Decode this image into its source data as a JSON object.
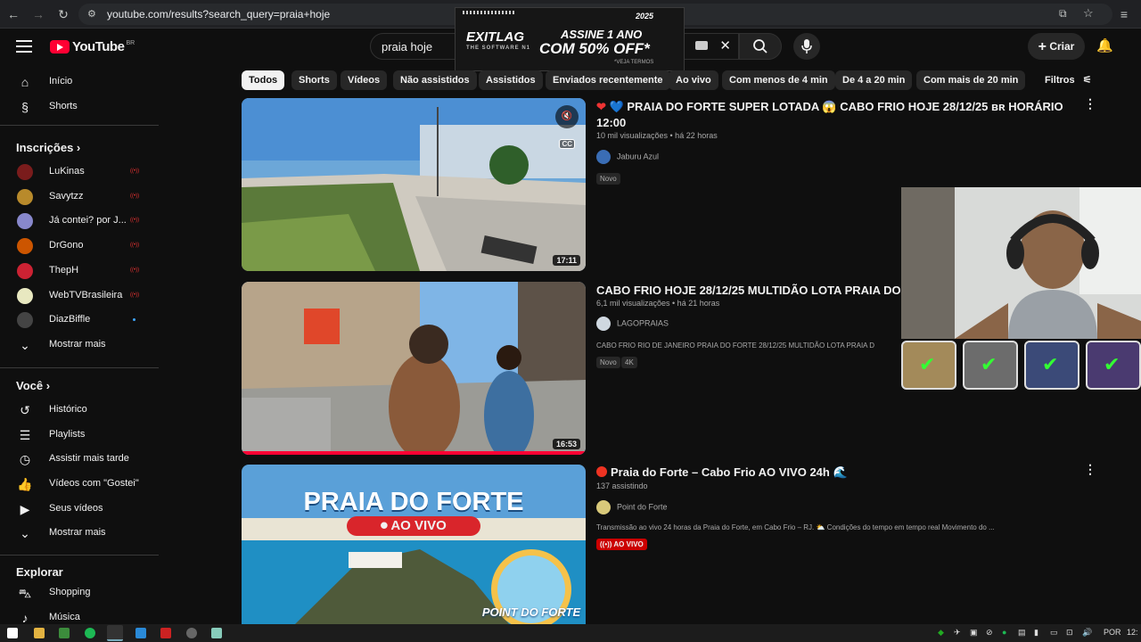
{
  "browser": {
    "url": "youtube.com/results?search_query=praia+hoje"
  },
  "ad": {
    "logo": "EXITLAG",
    "logo_sub": "THE SOFTWARE N1",
    "line1": "ASSINE 1 ANO",
    "line2": "COM 50% OFF*",
    "line3": "*VEJA TERMOS",
    "badge": "2025"
  },
  "masthead": {
    "logo_text": "YouTube",
    "country": "BR",
    "search_value": "praia hoje",
    "create_label": "Criar"
  },
  "sidebar": {
    "main": [
      {
        "label": "Início",
        "icon": "home-icon"
      },
      {
        "label": "Shorts",
        "icon": "shorts-icon"
      }
    ],
    "subs_header": "Inscrições",
    "subs": [
      {
        "label": "LuKinas",
        "live": true,
        "color": "#7a1c1c"
      },
      {
        "label": "Savytzz",
        "live": true,
        "color": "#b88a2b"
      },
      {
        "label": "Já contei? por J...",
        "live": true,
        "color": "#8888cc"
      },
      {
        "label": "DrGono",
        "live": true,
        "color": "#cc5500"
      },
      {
        "label": "ThepH",
        "live": true,
        "color": "#cc2233"
      },
      {
        "label": "WebTVBrasileira",
        "live": true,
        "color": "#e8e8c0"
      },
      {
        "label": "DiazBiffle",
        "live": false,
        "color": "#444"
      }
    ],
    "show_more_1": "Mostrar mais",
    "you_header": "Você",
    "you": [
      {
        "label": "Histórico",
        "icon": "history-icon"
      },
      {
        "label": "Playlists",
        "icon": "playlists-icon"
      },
      {
        "label": "Assistir mais tarde",
        "icon": "watch-later-icon"
      },
      {
        "label": "Vídeos com \"Gostei\"",
        "icon": "like-icon"
      },
      {
        "label": "Seus vídeos",
        "icon": "your-videos-icon"
      }
    ],
    "show_more_2": "Mostrar mais",
    "explore_header": "Explorar",
    "explore": [
      {
        "label": "Shopping",
        "icon": "shopping-icon"
      },
      {
        "label": "Música",
        "icon": "music-icon"
      }
    ]
  },
  "chips": [
    "Todos",
    "Shorts",
    "Vídeos",
    "Não assistidos",
    "Assistidos",
    "Enviados recentemente",
    "Ao vivo",
    "Com menos de 4 min",
    "De 4 a 20 min",
    "Com mais de 20 min"
  ],
  "filters_label": "Filtros",
  "results": [
    {
      "title": "PRAIA DO FORTE SUPER LOTADA 😱 CABO FRIO HOJE 28/12/25 ʙʀ HORÁRIO",
      "title2": "12:00",
      "meta": "10 mil visualizações • há 22 horas",
      "channel": "Jaburu Azul",
      "duration": "17:11",
      "badges": [
        "Novo"
      ],
      "desc": ""
    },
    {
      "title": "CABO FRIO HOJE 28/12/25 MULTIDÃO LOTA PRAIA DO",
      "meta": "6,1 mil visualizações • há 21 horas",
      "channel": "LAGOPRAIAS",
      "duration": "16:53",
      "desc": "CABO FRIO RIO DE JANEIRO PRAIA DO FORTE 28/12/25 MULTIDÃO LOTA PRAIA D",
      "badges": [
        "Novo",
        "4K"
      ]
    },
    {
      "title": "Praia do Forte – Cabo Frio AO VIVO 24h 🌊",
      "meta": "137 assistindo",
      "channel": "Point do Forte",
      "desc": "Transmissão ao vivo 24 horas da Praia do Forte, em Cabo Frio – RJ. ⛅ Condições do tempo em tempo real Movimento do ...",
      "live_badge": "AO VIVO",
      "thumb_title1": "PRAIA DO FORTE",
      "thumb_title2": "AO VIVO",
      "thumb_brand": "POINT DO FORTE"
    }
  ],
  "taskbar": {
    "lang": "POR",
    "time": "12:"
  }
}
